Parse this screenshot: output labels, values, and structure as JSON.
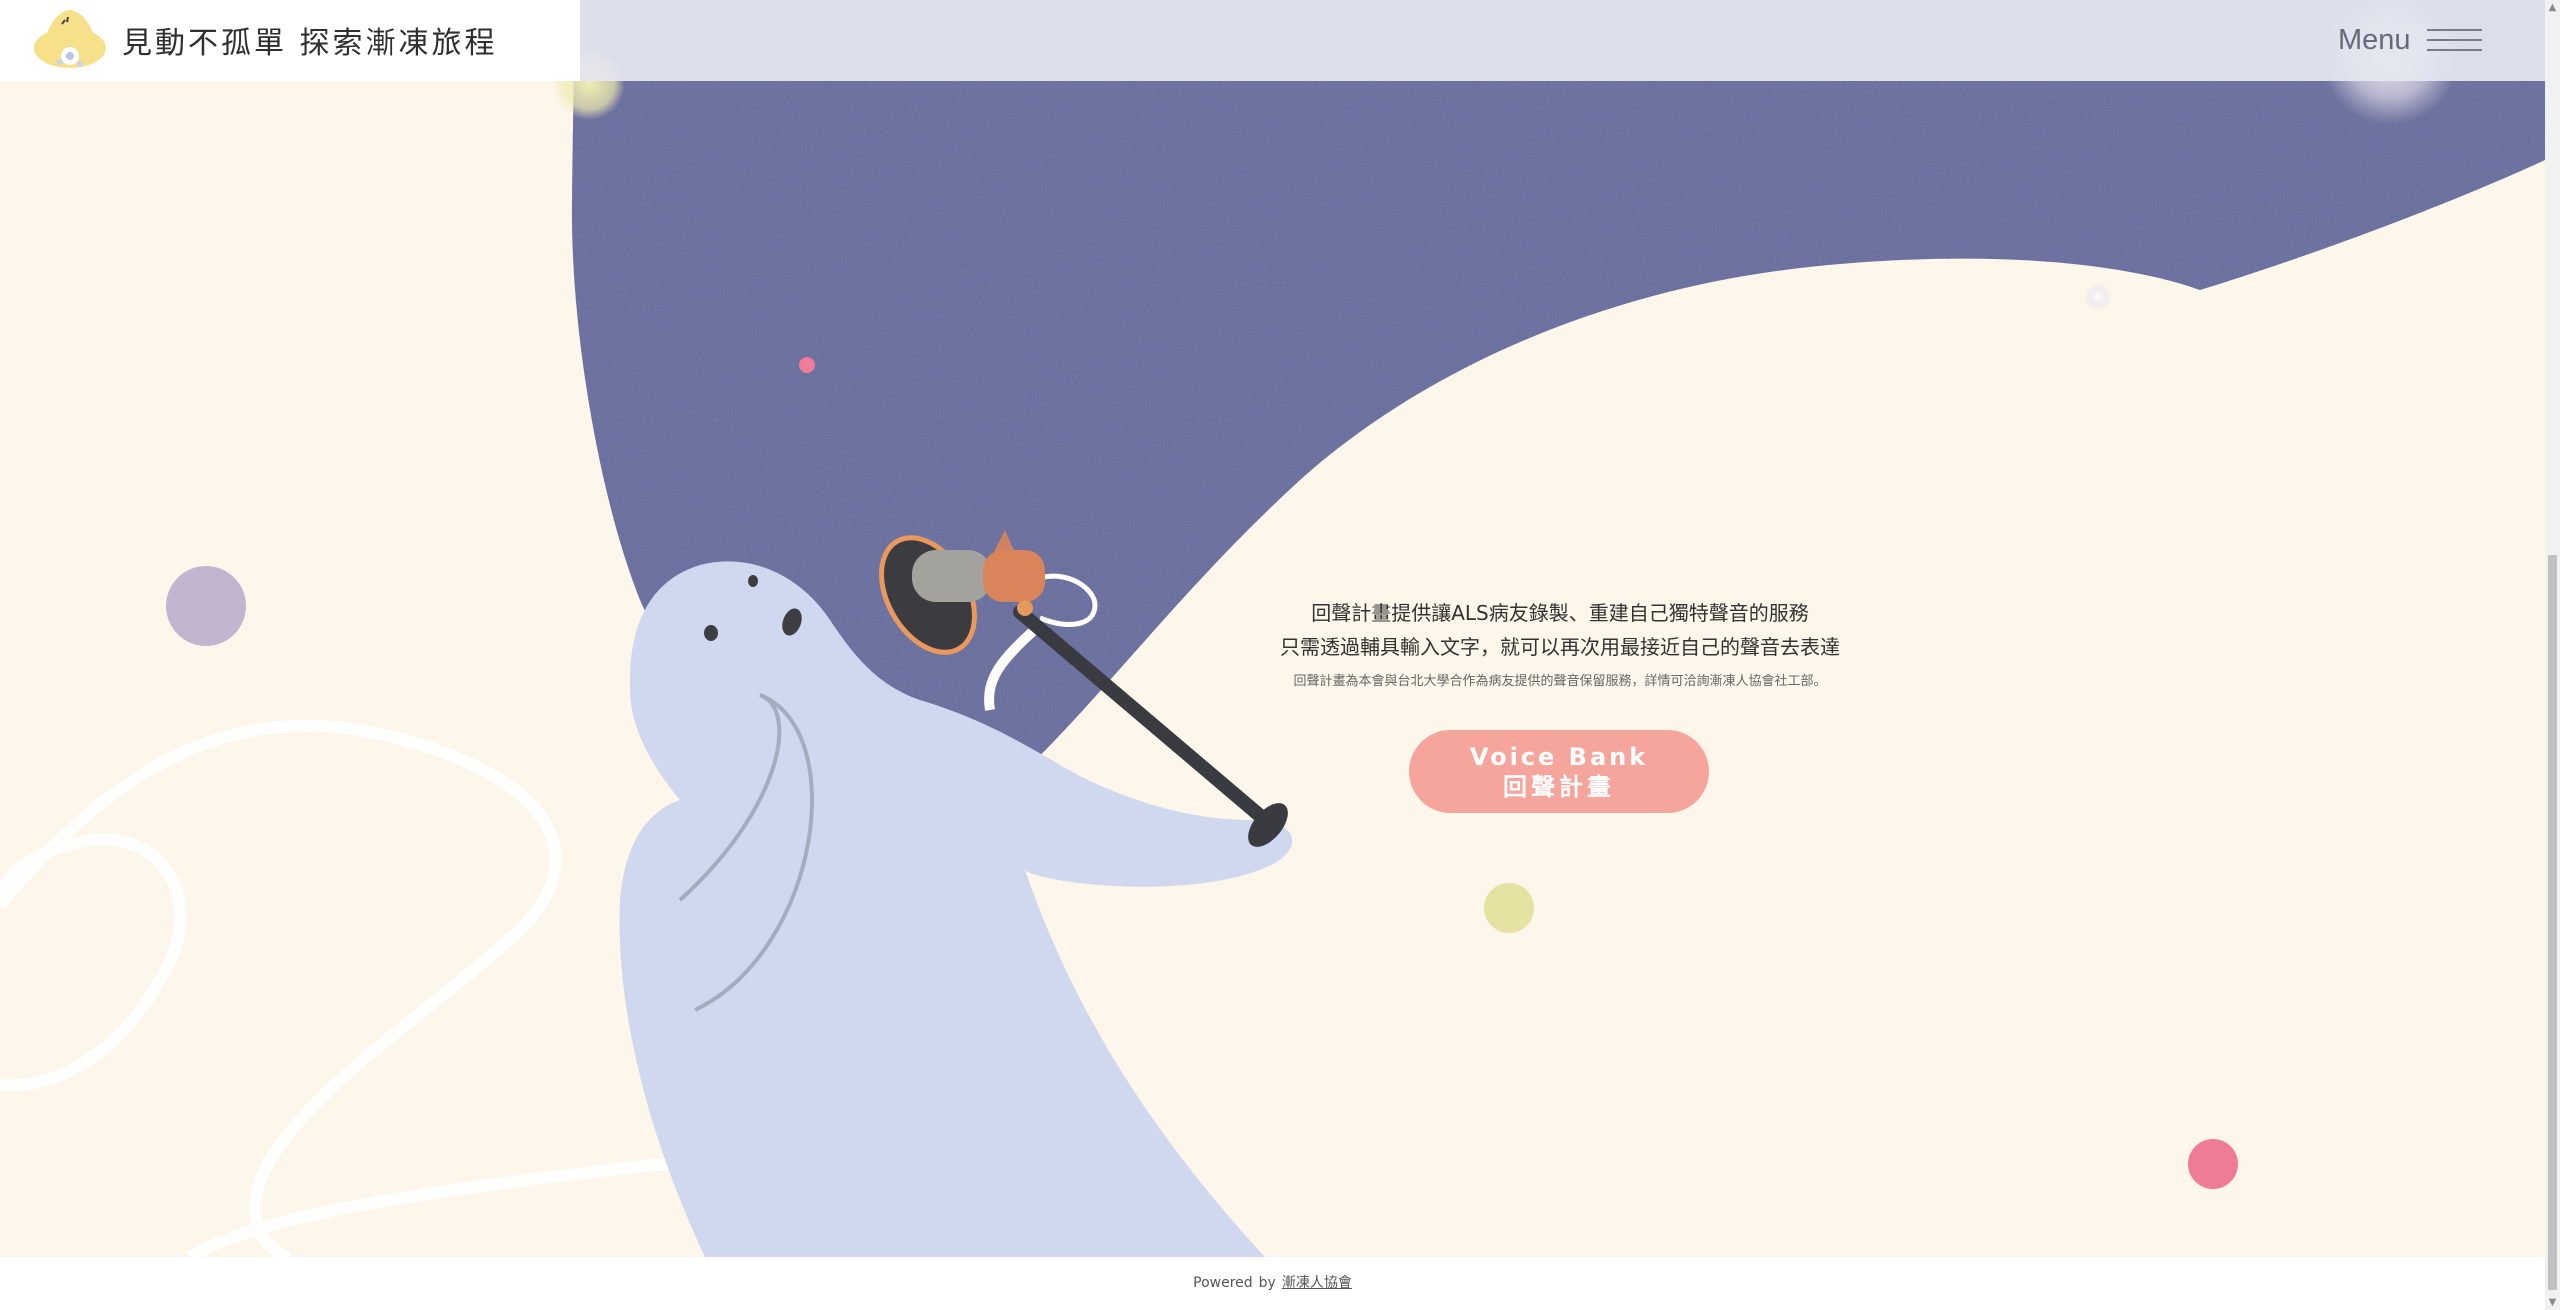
{
  "header": {
    "logo_icon": "flower-bell-mascot-icon",
    "tagline": "見動不孤單 探索漸凍旅程",
    "menu_label": "Menu",
    "menu_icon": "hamburger-icon"
  },
  "main": {
    "line1": "回聲計畫提供讓ALS病友錄製、重建自己獨特聲音的服務",
    "line2": "只需透過輔具輸入文字，就可以再次用最接近自己的聲音去表達",
    "note": "回聲計畫為本會與台北大學合作為病友提供的聲音保留服務，詳情可洽詢漸凍人協會社工部。",
    "button_en": "Voice Bank",
    "button_zh": "回聲計畫",
    "illustration_icon": "ghost-with-microphone-illustration"
  },
  "footer": {
    "powered": "Powered",
    "by": "by",
    "link": "漸凍人協會"
  },
  "colors": {
    "background": "#fdf6ea",
    "navy_blob": "#5d6499",
    "ghost": "#cfd8ee",
    "button": "#f5a59c",
    "pink_dot": "#ef7c97",
    "yellow_dot": "#e6e3a2",
    "lavender_dot": "#c2b5cf"
  }
}
